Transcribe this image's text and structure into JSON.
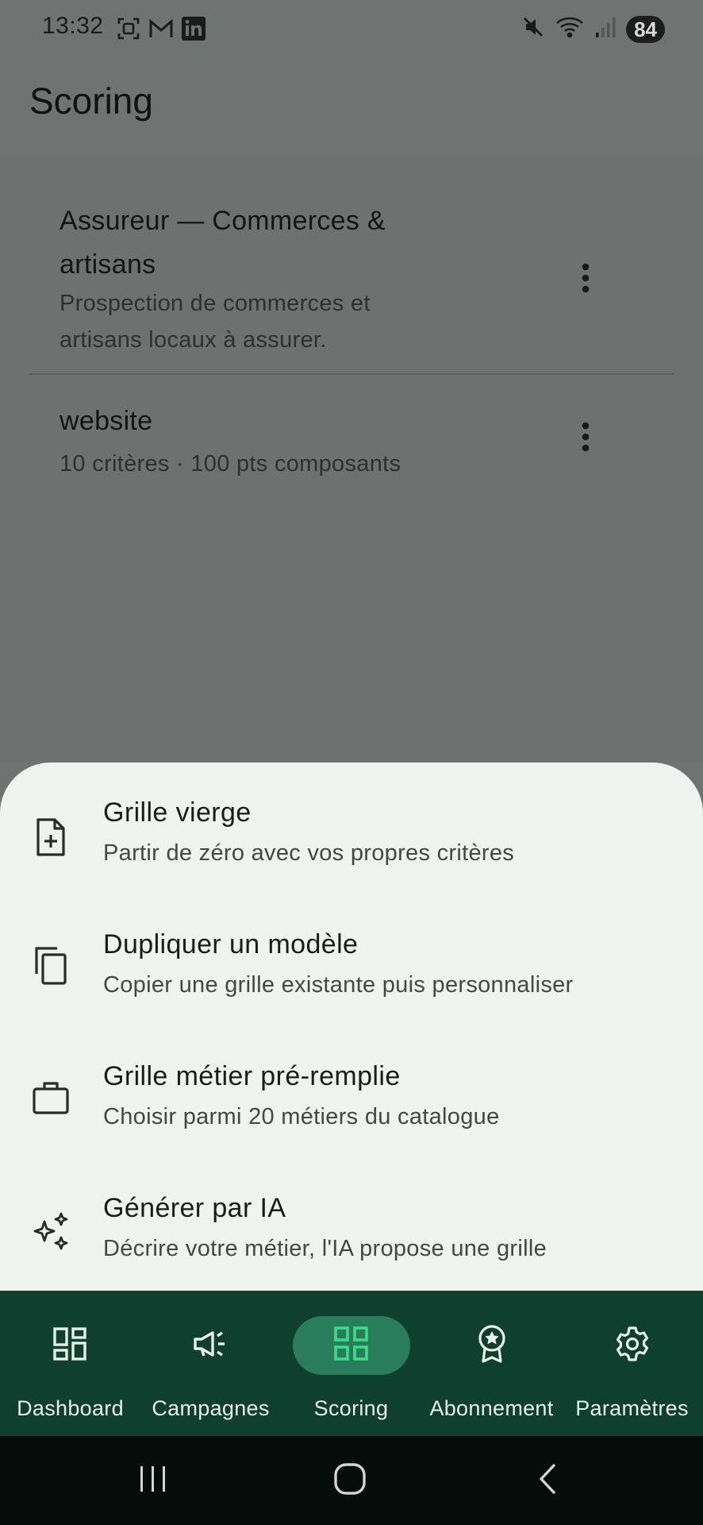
{
  "status_bar": {
    "time": "13:32",
    "battery": "84",
    "left_icons": [
      "screenshot-icon",
      "gmail-icon",
      "linkedin-icon"
    ],
    "right_icons": [
      "mute-icon",
      "wifi-icon",
      "signal-icon"
    ]
  },
  "app_bar": {
    "title": "Scoring"
  },
  "grids": [
    {
      "title": "Assureur — Commerces & artisans",
      "subtitle": "Prospection de commerces et artisans locaux à assurer."
    },
    {
      "title": "website",
      "subtitle": "10 critères · 100 pts composants"
    }
  ],
  "sheet": {
    "options": [
      {
        "title": "Grille vierge",
        "subtitle": "Partir de zéro avec vos propres critères",
        "icon": "file-plus-icon"
      },
      {
        "title": "Dupliquer un modèle",
        "subtitle": "Copier une grille existante puis personnaliser",
        "icon": "copy-icon"
      },
      {
        "title": "Grille métier pré-remplie",
        "subtitle": "Choisir parmi 20 métiers du catalogue",
        "icon": "briefcase-icon"
      },
      {
        "title": "Générer par IA",
        "subtitle": "Décrire votre métier, l'IA propose une grille",
        "icon": "sparkles-icon"
      }
    ]
  },
  "nav": {
    "items": [
      {
        "label": "Dashboard",
        "icon": "dashboard-icon"
      },
      {
        "label": "Campagnes",
        "icon": "megaphone-icon"
      },
      {
        "label": "Scoring",
        "icon": "grid-icon",
        "active": true
      },
      {
        "label": "Abonnement",
        "icon": "badge-icon"
      },
      {
        "label": "Paramètres",
        "icon": "gear-icon"
      }
    ]
  },
  "colors": {
    "scrim": "#6f7371",
    "sheet_bg": "#eff4f0",
    "nav_bg": "#0f3f2f",
    "nav_active_pill": "#2a7d5c",
    "nav_active_icon": "#3ddc84",
    "system_nav_bg": "#040d0a"
  }
}
